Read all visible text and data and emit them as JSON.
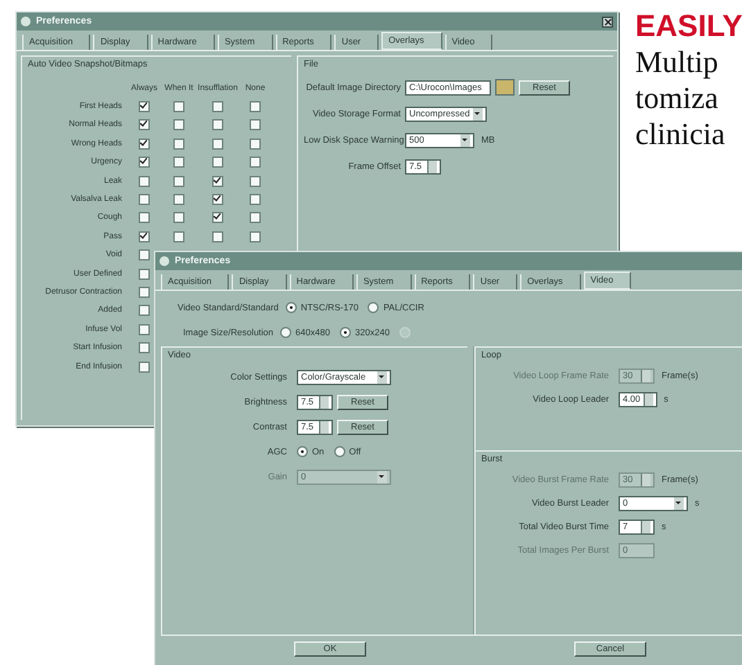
{
  "back_window": {
    "title": "Preferences",
    "tabs": [
      {
        "label": "Acquisition",
        "selected": false
      },
      {
        "label": "Display",
        "selected": false
      },
      {
        "label": "Hardware",
        "selected": false
      },
      {
        "label": "System",
        "selected": false
      },
      {
        "label": "Reports",
        "selected": false
      },
      {
        "label": "User",
        "selected": false
      },
      {
        "label": "Overlays",
        "selected": true
      },
      {
        "label": "Video",
        "selected": false
      }
    ],
    "snapshots": {
      "title": "Auto Video Snapshot/Bitmaps",
      "columns": [
        "Always",
        "When It",
        "Insufflation",
        "None"
      ],
      "rows": [
        {
          "label": "First Heads",
          "options": [
            true,
            false,
            false,
            false
          ]
        },
        {
          "label": "Normal Heads",
          "options": [
            true,
            false,
            false,
            false
          ]
        },
        {
          "label": "Wrong Heads",
          "options": [
            true,
            false,
            false,
            false
          ]
        },
        {
          "label": "Urgency",
          "options": [
            true,
            false,
            false,
            false
          ]
        },
        {
          "label": "Leak",
          "options": [
            false,
            false,
            true,
            false
          ]
        },
        {
          "label": "Valsalva Leak",
          "options": [
            false,
            false,
            true,
            false
          ]
        },
        {
          "label": "Cough",
          "options": [
            false,
            false,
            true,
            false
          ]
        },
        {
          "label": "Pass",
          "options": [
            true,
            false,
            false,
            false
          ]
        },
        {
          "label": "Void",
          "options": [
            false
          ]
        },
        {
          "label": "User Defined",
          "options": [
            false
          ]
        },
        {
          "label": "Detrusor Contraction",
          "options": [
            false
          ]
        },
        {
          "label": "Added",
          "options": [
            false
          ]
        },
        {
          "label": "Infuse Vol",
          "options": [
            false
          ]
        },
        {
          "label": "Start Infusion",
          "options": [
            false
          ]
        },
        {
          "label": "End Infusion",
          "options": [
            false
          ]
        }
      ]
    },
    "file": {
      "title": "File",
      "fields": [
        {
          "kind": "path",
          "label": "Default Image Directory",
          "value": "C:\\Urocon\\Images",
          "button": "Reset"
        },
        {
          "kind": "dropdown",
          "label": "Video Storage Format",
          "value": "Uncompressed"
        },
        {
          "kind": "dropdown",
          "label": "Low Disk Space Warning",
          "value": "500",
          "unit": "MB"
        },
        {
          "kind": "spin",
          "label": "Frame Offset",
          "value": "7.5"
        }
      ]
    }
  },
  "front_window": {
    "title": "Preferences",
    "tabs": [
      {
        "label": "Acquisition",
        "selected": false
      },
      {
        "label": "Display",
        "selected": false
      },
      {
        "label": "Hardware",
        "selected": false
      },
      {
        "label": "System",
        "selected": false
      },
      {
        "label": "Reports",
        "selected": false
      },
      {
        "label": "User",
        "selected": false
      },
      {
        "label": "Overlays",
        "selected": false
      },
      {
        "label": "Video",
        "selected": true
      }
    ],
    "choices": [
      {
        "label": "Video Standard/Standard",
        "options": [
          {
            "label": "NTSC/RS-170",
            "selected": true,
            "disabled": false
          },
          {
            "label": "PAL/CCIR",
            "selected": false,
            "disabled": false
          }
        ]
      },
      {
        "label": "Image Size/Resolution",
        "options": [
          {
            "label": "640x480",
            "selected": false,
            "disabled": false
          },
          {
            "label": "320x240",
            "selected": true,
            "disabled": false
          },
          {
            "selected": false,
            "disabled": true
          }
        ]
      }
    ],
    "video": {
      "title": "Video",
      "fields": [
        {
          "kind": "dropdown",
          "label": "Color Settings",
          "value": "Color/Grayscale",
          "disabled": false
        },
        {
          "kind": "spin",
          "label": "Brightness",
          "value": "7.5",
          "button": "Reset",
          "disabled": false
        },
        {
          "kind": "spin",
          "label": "Contrast",
          "value": "7.5",
          "button": "Reset",
          "disabled": false
        },
        {
          "kind": "radio",
          "label": "AGC",
          "options": [
            {
              "label": "On",
              "selected": true
            },
            {
              "label": "Off",
              "selected": false
            }
          ],
          "disabled": false
        },
        {
          "kind": "dropdown",
          "label": "Gain",
          "value": "0",
          "disabled": true
        }
      ]
    },
    "loop": {
      "title": "Loop",
      "fields": [
        {
          "kind": "spin",
          "label": "Video Loop Frame Rate",
          "value": "30",
          "unit": "Frame(s)",
          "disabled": true
        },
        {
          "kind": "spin",
          "label": "Video Loop Leader",
          "value": "4.00",
          "unit": "s",
          "disabled": false
        }
      ]
    },
    "burst": {
      "title": "Burst",
      "fields": [
        {
          "kind": "spin",
          "label": "Video Burst Frame Rate",
          "value": "30",
          "unit": "Frame(s)",
          "disabled": true
        },
        {
          "kind": "dropdown",
          "label": "Video Burst Leader",
          "value": "0",
          "unit": "s",
          "disabled": false
        },
        {
          "kind": "spin",
          "label": "Total Video Burst Time",
          "value": "7",
          "unit": "s",
          "disabled": false
        },
        {
          "kind": "text",
          "label": "Total Images Per Burst",
          "value": "0",
          "disabled": true
        }
      ]
    },
    "buttons": [
      "OK",
      "Cancel"
    ]
  },
  "side_text": {
    "heading": "EASILY",
    "lines": [
      "Multip",
      "tomiza",
      "clinicia"
    ]
  }
}
